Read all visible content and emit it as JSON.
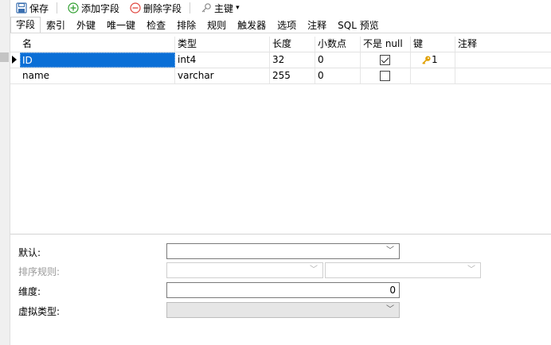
{
  "toolbar": {
    "save_label": "保存",
    "add_field_label": "添加字段",
    "delete_field_label": "删除字段",
    "primary_key_label": "主键"
  },
  "tabs": [
    {
      "label": "字段",
      "active": true
    },
    {
      "label": "索引"
    },
    {
      "label": "外键"
    },
    {
      "label": "唯一键"
    },
    {
      "label": "检查"
    },
    {
      "label": "排除"
    },
    {
      "label": "规则"
    },
    {
      "label": "触发器"
    },
    {
      "label": "选项"
    },
    {
      "label": "注释"
    },
    {
      "label": "SQL 预览"
    }
  ],
  "grid": {
    "columns": {
      "name": "名",
      "type": "类型",
      "length": "长度",
      "decimals": "小数点",
      "not_null": "不是 null",
      "key": "键",
      "comment": "注释"
    },
    "rows": [
      {
        "name": "ID",
        "type": "int4",
        "length": "32",
        "decimals": "0",
        "not_null": true,
        "key": "1",
        "comment": "",
        "selected": true
      },
      {
        "name": "name",
        "type": "varchar",
        "length": "255",
        "decimals": "0",
        "not_null": false,
        "key": "",
        "comment": "",
        "selected": false
      }
    ]
  },
  "properties": {
    "default_label": "默认:",
    "collation_label": "排序规则:",
    "dimension_label": "维度:",
    "dimension_value": "0",
    "virtual_type_label": "虚拟类型:"
  },
  "colors": {
    "selection": "#0a6fd6",
    "add_icon": "#2e9e2e",
    "delete_icon": "#e0443c",
    "key_icon": "#e0a000"
  }
}
